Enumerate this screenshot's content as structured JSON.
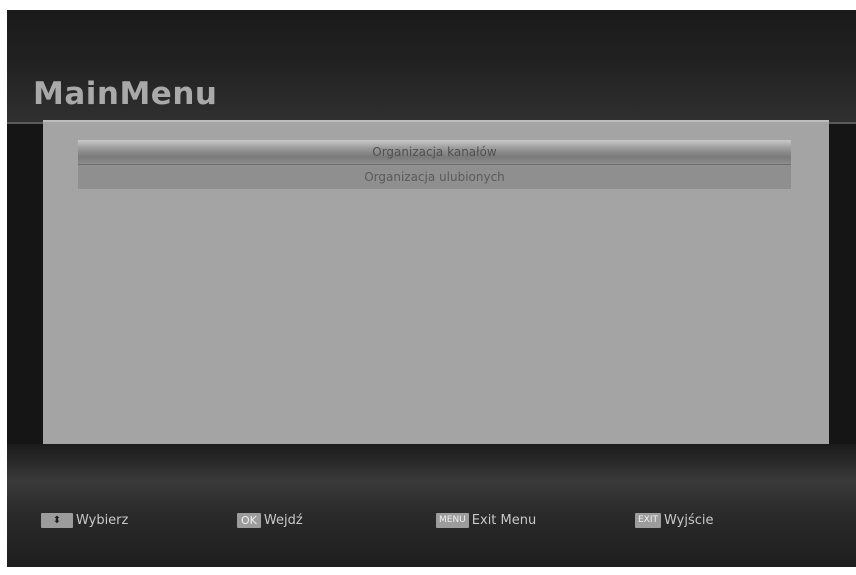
{
  "header": {
    "title": "MainMenu"
  },
  "menu": {
    "items": [
      {
        "label": "Organizacja kanałów",
        "selected": true
      },
      {
        "label": "Organizacja ulubionych",
        "selected": false
      }
    ]
  },
  "help_bar": {
    "items": [
      {
        "key": "⬍",
        "key_icon": "up-down-arrow-icon",
        "label": "Wybierz"
      },
      {
        "key": "OK",
        "label": "Wejdź"
      },
      {
        "key": "MENU",
        "label": "Exit Menu"
      },
      {
        "key": "EXIT",
        "label": "Wyjście"
      }
    ]
  }
}
